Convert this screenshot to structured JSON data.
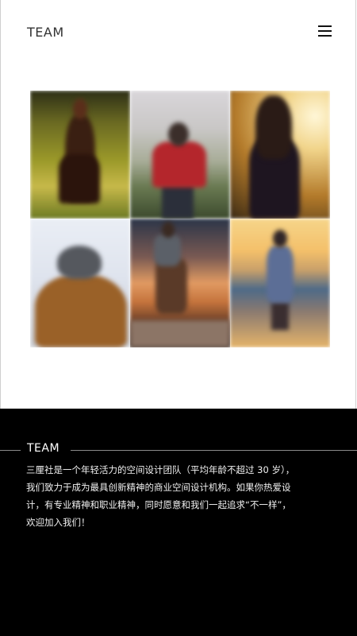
{
  "header": {
    "brand": "TEAM",
    "menu_icon": "hamburger-menu-icon"
  },
  "gallery": {
    "photos": [
      {
        "subject": "woman-in-field-photo"
      },
      {
        "subject": "person-red-jacket-photo"
      },
      {
        "subject": "woman-sunlight-photo"
      },
      {
        "subject": "person-fur-hood-photo"
      },
      {
        "subject": "hiker-backpack-photo"
      },
      {
        "subject": "woman-beach-sunset-photo"
      }
    ]
  },
  "footer": {
    "section_title": "TEAM",
    "description": "三厘社是一个年轻活力的空间设计团队（平均年龄不超过 30 岁），我们致力于成为最具创新精神的商业空间设计机构。如果你热爱设计，有专业精神和职业精神，同时愿意和我们一起追求“不一样”，欢迎加入我们！"
  },
  "colors": {
    "footer_bg": "#000000",
    "page_bg": "#ffffff",
    "text_dark": "#333333",
    "text_light": "#ffffff"
  }
}
